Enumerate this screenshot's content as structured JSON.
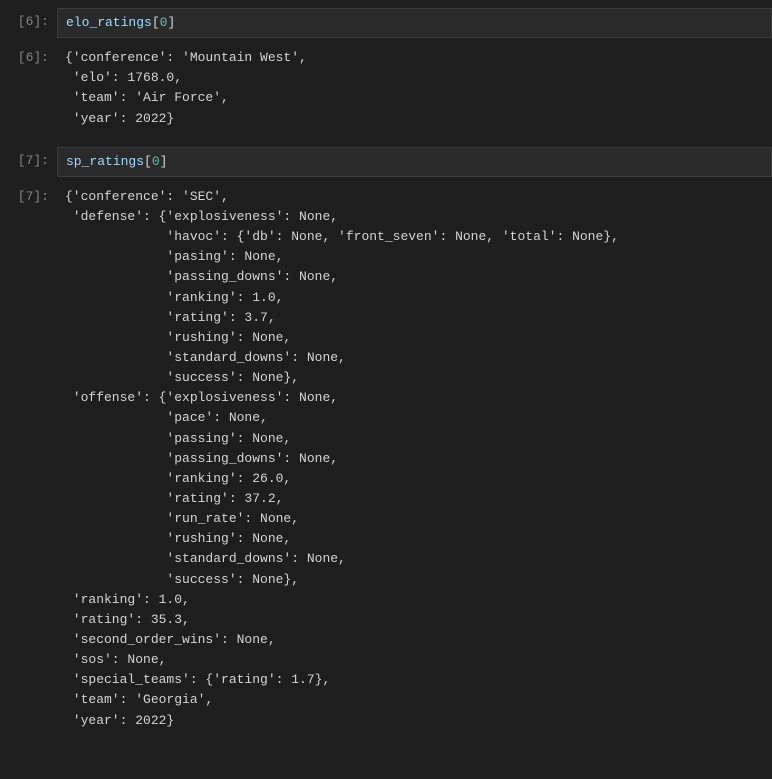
{
  "cells": [
    {
      "prompt": "[6]:",
      "type": "code",
      "seg": [
        {
          "t": "elo_ratings",
          "c": "c-blue"
        },
        {
          "t": "[",
          "c": ""
        },
        {
          "t": "0",
          "c": "c-teal"
        },
        {
          "t": "]",
          "c": ""
        }
      ]
    },
    {
      "prompt": "[6]:",
      "type": "output",
      "lines": [
        "{'conference': 'Mountain West',",
        " 'elo': 1768.0,",
        " 'team': 'Air Force',",
        " 'year': 2022}"
      ]
    },
    {
      "prompt": "[7]:",
      "type": "code",
      "seg": [
        {
          "t": "sp_ratings",
          "c": "c-blue"
        },
        {
          "t": "[",
          "c": ""
        },
        {
          "t": "0",
          "c": "c-teal"
        },
        {
          "t": "]",
          "c": ""
        }
      ]
    },
    {
      "prompt": "[7]:",
      "type": "output",
      "lines": [
        "{'conference': 'SEC',",
        " 'defense': {'explosiveness': None,",
        "             'havoc': {'db': None, 'front_seven': None, 'total': None},",
        "             'pasing': None,",
        "             'passing_downs': None,",
        "             'ranking': 1.0,",
        "             'rating': 3.7,",
        "             'rushing': None,",
        "             'standard_downs': None,",
        "             'success': None},",
        " 'offense': {'explosiveness': None,",
        "             'pace': None,",
        "             'passing': None,",
        "             'passing_downs': None,",
        "             'ranking': 26.0,",
        "             'rating': 37.2,",
        "             'run_rate': None,",
        "             'rushing': None,",
        "             'standard_downs': None,",
        "             'success': None},",
        " 'ranking': 1.0,",
        " 'rating': 35.3,",
        " 'second_order_wins': None,",
        " 'sos': None,",
        " 'special_teams': {'rating': 1.7},",
        " 'team': 'Georgia',",
        " 'year': 2022}"
      ]
    }
  ]
}
